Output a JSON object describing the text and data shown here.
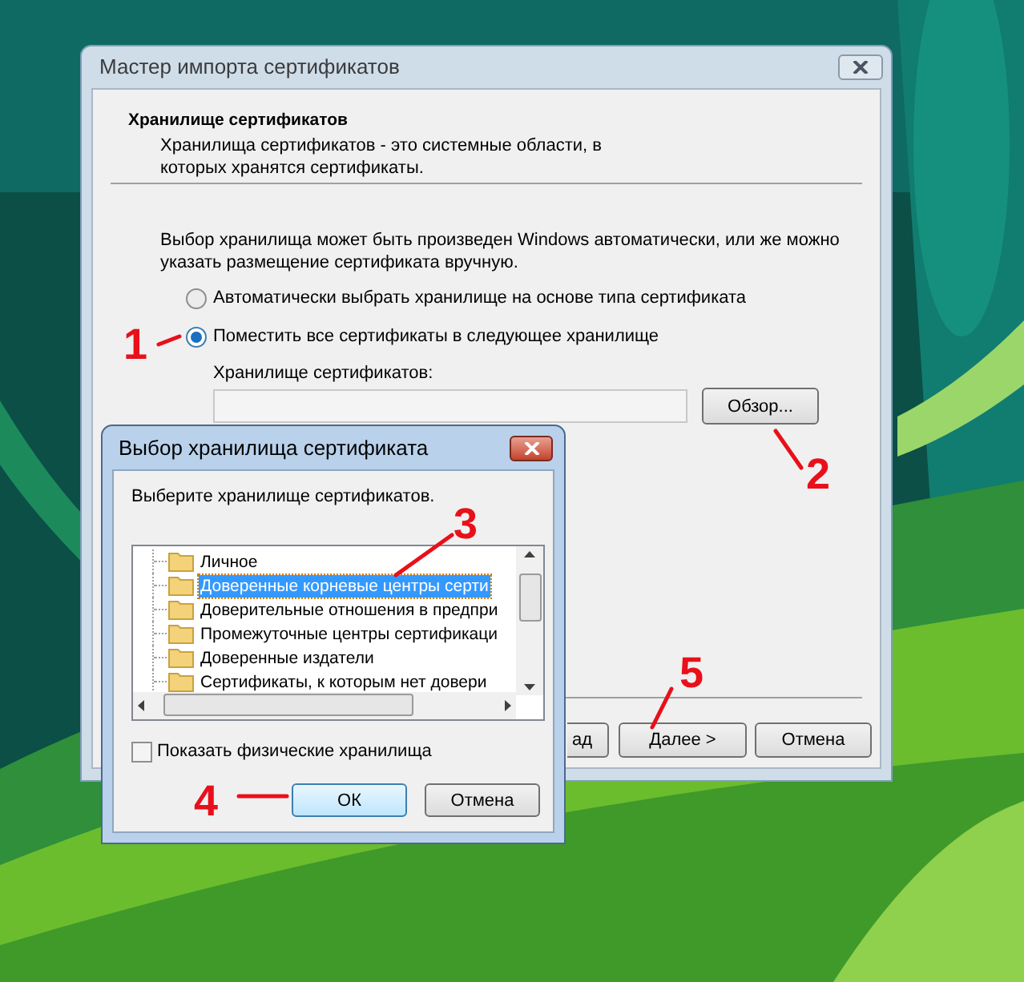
{
  "main_window": {
    "title": "Мастер импорта сертификатов",
    "heading": "Хранилище сертификатов",
    "description": "Хранилища сертификатов - это системные области, в которых хранятся сертификаты.",
    "intro": "Выбор хранилища может быть произведен Windows автоматически, или же можно указать размещение сертификата вручную.",
    "options": [
      {
        "label": "Автоматически выбрать хранилище на основе типа сертификата",
        "selected": false
      },
      {
        "label": "Поместить все сертификаты в следующее хранилище",
        "selected": true
      }
    ],
    "store_label": "Хранилище сертификатов:",
    "browse_button": "Обзор...",
    "buttons": [
      "ад",
      "Далее >",
      "Отмена"
    ]
  },
  "dialog": {
    "title": "Выбор хранилища сертификата",
    "prompt": "Выберите хранилище сертификатов.",
    "stores": [
      {
        "label": "Личное",
        "selected": false
      },
      {
        "label": "Доверенные корневые центры серти",
        "selected": true
      },
      {
        "label": "Доверительные отношения в предпри",
        "selected": false
      },
      {
        "label": "Промежуточные центры сертификаци",
        "selected": false
      },
      {
        "label": "Доверенные издатели",
        "selected": false
      },
      {
        "label": "Сертификаты, к которым нет довери",
        "selected": false
      }
    ],
    "show_physical": {
      "label": "Показать физические хранилища",
      "checked": false
    },
    "buttons": [
      "ОК",
      "Отмена"
    ]
  },
  "callouts": [
    {
      "text": "1"
    },
    {
      "text": "2"
    },
    {
      "text": "3"
    },
    {
      "text": "4"
    },
    {
      "text": "5"
    }
  ]
}
